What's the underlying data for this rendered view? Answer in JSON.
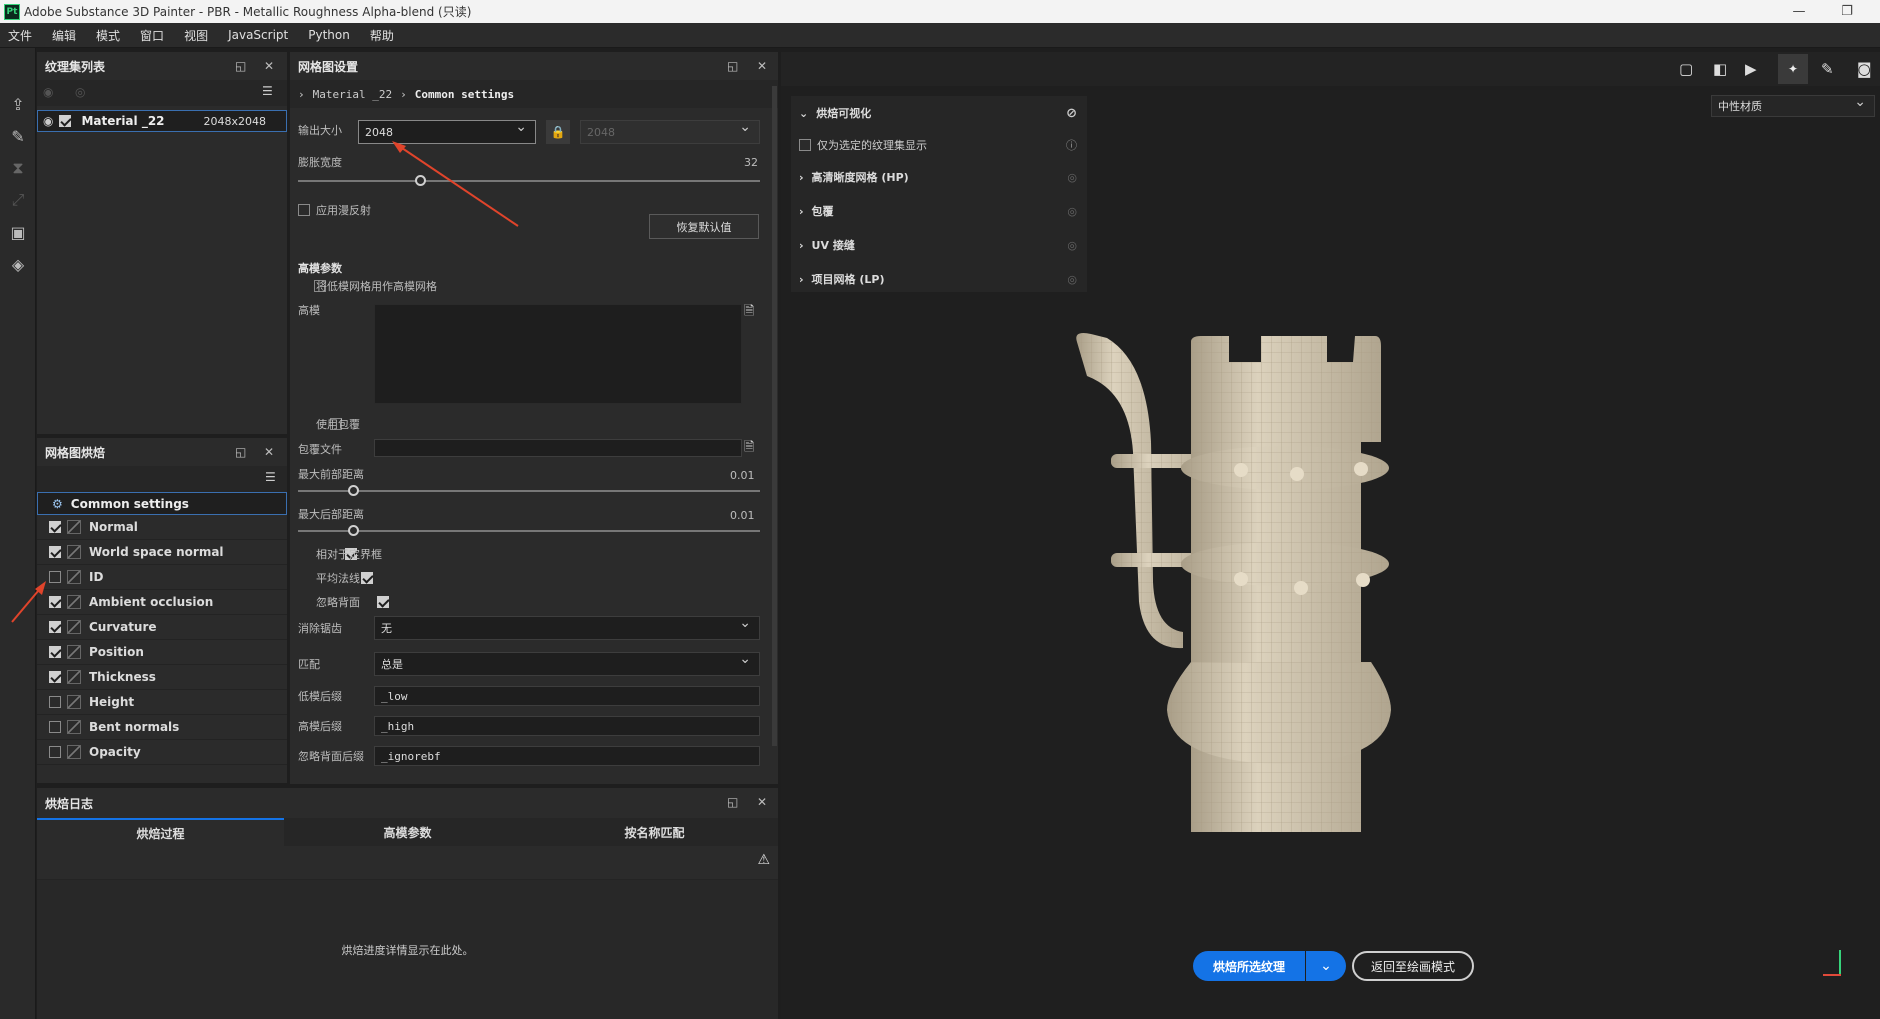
{
  "window": {
    "title": "Adobe Substance 3D Painter - PBR - Metallic Roughness Alpha-blend (只读)",
    "logo": "Pt"
  },
  "menu": [
    "文件",
    "编辑",
    "模式",
    "窗口",
    "视图",
    "JavaScript",
    "Python",
    "帮助"
  ],
  "texture_set_panel": {
    "title": "纹理集列表",
    "item_name": "Material _22",
    "item_size": "2048x2048"
  },
  "bake_settings_panel": {
    "title": "网格图设置",
    "breadcrumb_1": "Material _22",
    "breadcrumb_2": "Common settings",
    "output_size_label": "输出大小",
    "output_size_value": "2048",
    "output_size_locked_value": "2048",
    "dilation_label": "膨胀宽度",
    "dilation_value": "32",
    "dilation_fraction": 0.26,
    "apply_diffusion_label": "应用漫反射",
    "reset_button": "恢复默认值",
    "high_poly_section": "高模参数",
    "use_low_as_high_label": "将低模网格用作高模网格",
    "high_poly_label": "高模",
    "use_cage_label": "使用包覆",
    "cage_file_label": "包覆文件",
    "max_front_label": "最大前部距离",
    "max_front_value": "0.01",
    "max_front_fraction": 0.11,
    "max_rear_label": "最大后部距离",
    "max_rear_value": "0.01",
    "max_rear_fraction": 0.11,
    "relative_bbox_label": "相对于定界框",
    "average_normals_label": "平均法线",
    "ignore_backface_label": "忽略背面",
    "antialias_label": "消除锯齿",
    "antialias_value": "无",
    "match_label": "匹配",
    "match_value": "总是",
    "low_suffix_label": "低模后缀",
    "low_suffix_value": "_low",
    "high_suffix_label": "高模后缀",
    "high_suffix_value": "_high",
    "ignore_suffix_label": "忽略背面后缀",
    "ignore_suffix_value": "_ignorebf"
  },
  "map_list_panel": {
    "title": "网格图烘焙",
    "common": "Common settings",
    "maps": [
      {
        "name": "Normal",
        "checked": true
      },
      {
        "name": "World space normal",
        "checked": true
      },
      {
        "name": "ID",
        "checked": false
      },
      {
        "name": "Ambient occlusion",
        "checked": true
      },
      {
        "name": "Curvature",
        "checked": true
      },
      {
        "name": "Position",
        "checked": true
      },
      {
        "name": "Thickness",
        "checked": true
      },
      {
        "name": "Height",
        "checked": false
      },
      {
        "name": "Bent normals",
        "checked": false
      },
      {
        "name": "Opacity",
        "checked": false
      }
    ]
  },
  "bake_log_panel": {
    "title": "烘焙日志",
    "tabs": [
      "烘焙过程",
      "高模参数",
      "按名称匹配"
    ],
    "message": "烘焙进度详情显示在此处。"
  },
  "viewport": {
    "material_dropdown": "中性材质",
    "visualization": {
      "title": "烘焙可视化",
      "only_selected": "仅为选定的纹理集显示",
      "items": [
        "高清晰度网格 (HP)",
        "包覆",
        "UV 接缝",
        "项目网格 (LP)"
      ]
    },
    "bake_button": "烘焙所选纹理",
    "return_button": "返回至绘画模式"
  },
  "colors": {
    "accent": "#1473e6",
    "annotation": "#e0442b"
  }
}
